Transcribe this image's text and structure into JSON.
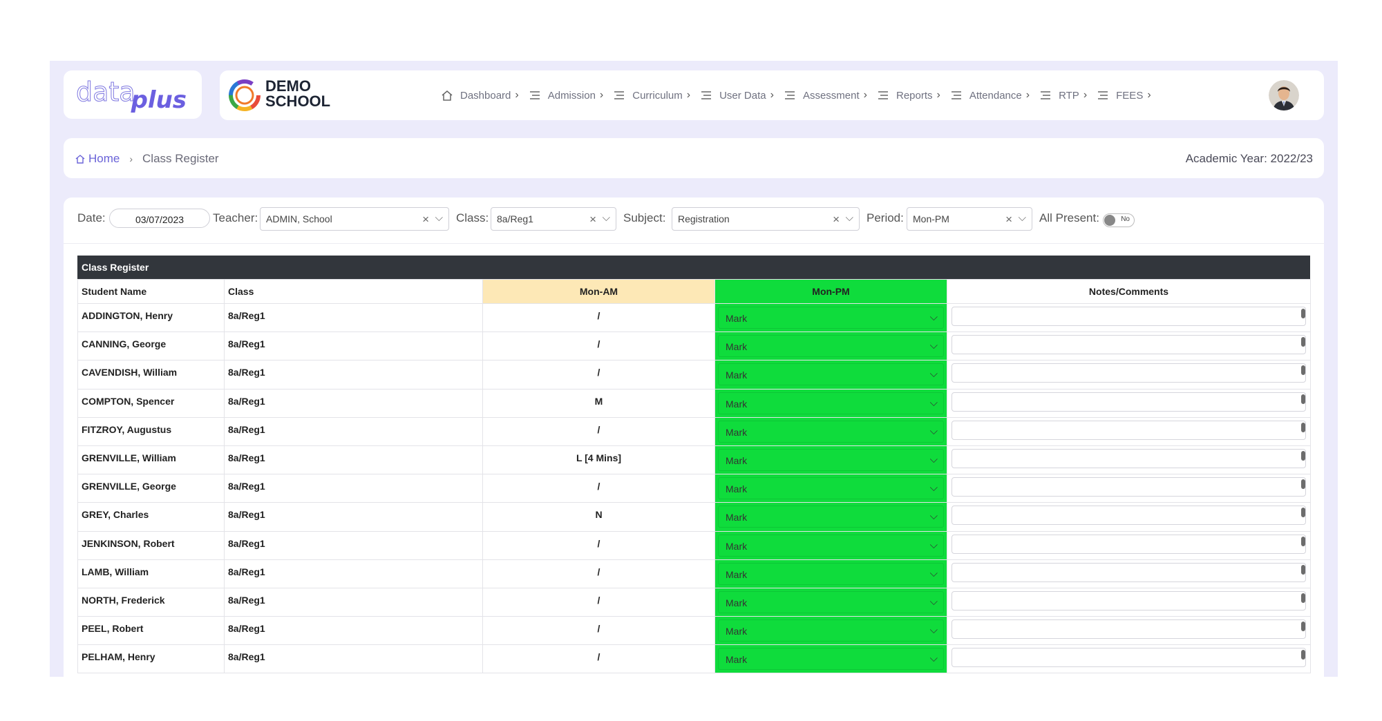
{
  "brand": {
    "logo_data": "data",
    "logo_plus": "plus",
    "school_line1": "DEMO",
    "school_line2": "SCHOOL"
  },
  "nav": [
    {
      "label": "Dashboard",
      "icon": "home-icon"
    },
    {
      "label": "Admission",
      "icon": "menu-icon"
    },
    {
      "label": "Curriculum",
      "icon": "menu-icon"
    },
    {
      "label": "User Data",
      "icon": "menu-icon"
    },
    {
      "label": "Assessment",
      "icon": "menu-icon"
    },
    {
      "label": "Reports",
      "icon": "menu-icon"
    },
    {
      "label": "Attendance",
      "icon": "menu-icon"
    },
    {
      "label": "RTP",
      "icon": "menu-icon"
    },
    {
      "label": "FEES",
      "icon": "menu-icon"
    }
  ],
  "breadcrumb": {
    "home": "Home",
    "current": "Class Register"
  },
  "academic_year": "Academic Year: 2022/23",
  "filters": {
    "date_label": "Date:",
    "date_value": "03/07/2023",
    "teacher_label": "Teacher:",
    "teacher_value": "ADMIN, School",
    "class_label": "Class:",
    "class_value": "8a/Reg1",
    "subject_label": "Subject:",
    "subject_value": "Registration",
    "period_label": "Period:",
    "period_value": "Mon-PM",
    "all_present_label": "All Present:",
    "all_present_value": "No",
    "clear_glyph": "×",
    "dropdown_glyph": "⌵"
  },
  "register": {
    "title": "Class Register",
    "columns": {
      "student": "Student Name",
      "class": "Class",
      "am": "Mon-AM",
      "pm": "Mon-PM",
      "notes": "Notes/Comments"
    },
    "mark_placeholder": "Mark",
    "colors": {
      "pm_green": "#0fdc3c",
      "am_header": "#fde8b6",
      "title_bar": "#32363c"
    },
    "rows": [
      {
        "name": "ADDINGTON, Henry",
        "class": "8a/Reg1",
        "am": "/"
      },
      {
        "name": "CANNING, George",
        "class": "8a/Reg1",
        "am": "/"
      },
      {
        "name": "CAVENDISH, William",
        "class": "8a/Reg1",
        "am": "/"
      },
      {
        "name": "COMPTON, Spencer",
        "class": "8a/Reg1",
        "am": "M"
      },
      {
        "name": "FITZROY, Augustus",
        "class": "8a/Reg1",
        "am": "/"
      },
      {
        "name": "GRENVILLE, William",
        "class": "8a/Reg1",
        "am": "L [4 Mins]"
      },
      {
        "name": "GRENVILLE, George",
        "class": "8a/Reg1",
        "am": "/"
      },
      {
        "name": "GREY, Charles",
        "class": "8a/Reg1",
        "am": "N"
      },
      {
        "name": "JENKINSON, Robert",
        "class": "8a/Reg1",
        "am": "/"
      },
      {
        "name": "LAMB, William",
        "class": "8a/Reg1",
        "am": "/"
      },
      {
        "name": "NORTH, Frederick",
        "class": "8a/Reg1",
        "am": "/"
      },
      {
        "name": "PEEL, Robert",
        "class": "8a/Reg1",
        "am": "/"
      },
      {
        "name": "PELHAM, Henry",
        "class": "8a/Reg1",
        "am": "/"
      }
    ]
  }
}
